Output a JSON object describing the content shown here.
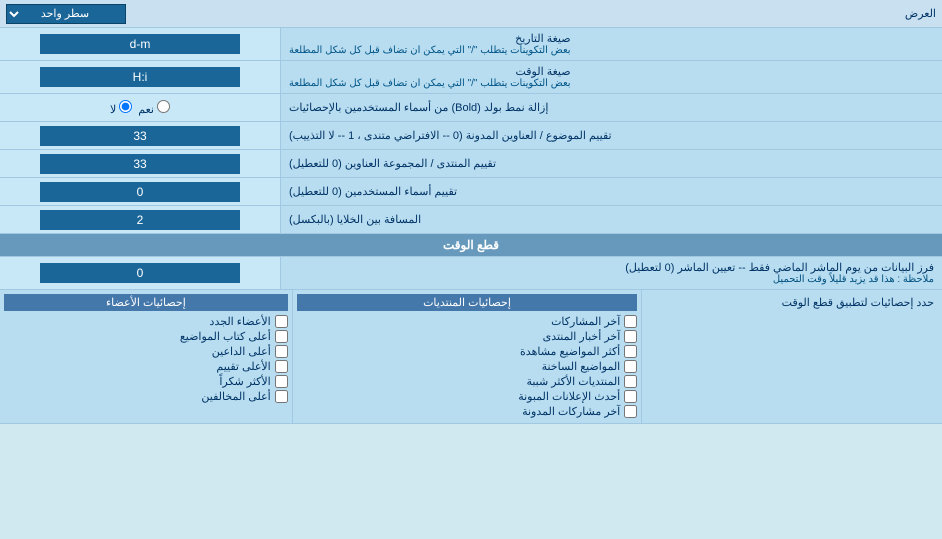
{
  "page": {
    "title": "العرض"
  },
  "rows": [
    {
      "id": "display-row",
      "label": "العرض",
      "input_type": "dropdown",
      "input_value": "سطر واحد"
    },
    {
      "id": "date-format",
      "label": "صيغة التاريخ",
      "sub_label": "بعض التكوينات يتطلب \"/\" التي يمكن ان تضاف قبل كل شكل المطلعة",
      "input_type": "text",
      "input_value": "d-m"
    },
    {
      "id": "time-format",
      "label": "صيغة الوقت",
      "sub_label": "بعض التكوينات يتطلب \"/\" التي يمكن ان تضاف قبل كل شكل المطلعة",
      "input_type": "text",
      "input_value": "H:i"
    },
    {
      "id": "remove-bold",
      "label": "إزالة نمط بولد (Bold) من أسماء المستخدمين بالإحصائيات",
      "input_type": "radio",
      "options": [
        {
          "label": "نعم",
          "value": "yes"
        },
        {
          "label": "لا",
          "value": "no",
          "checked": true
        }
      ]
    },
    {
      "id": "topics-order",
      "label": "تقييم الموضوع / العناوين المدونة (0 -- الافتراضي متندى ، 1 -- لا التذييب)",
      "input_type": "text",
      "input_value": "33"
    },
    {
      "id": "forum-order",
      "label": "تقييم المنتدى / المجموعة العناوين (0 للتعطيل)",
      "input_type": "text",
      "input_value": "33"
    },
    {
      "id": "usernames-order",
      "label": "تقييم أسماء المستخدمين (0 للتعطيل)",
      "input_type": "text",
      "input_value": "0"
    },
    {
      "id": "cell-spacing",
      "label": "المسافة بين الخلايا (بالبكسل)",
      "input_type": "text",
      "input_value": "2"
    }
  ],
  "cut_time_section": {
    "title": "قطع الوقت",
    "row": {
      "label": "فرز البيانات من يوم الماشر الماضي فقط -- تعيين الماشر (0 لتعطيل)",
      "sub_label": "ملاحظة : هذا قد يزيد قليلاً وقت التحميل",
      "input_value": "0"
    }
  },
  "stats_section": {
    "title": "حدد إحصائيات لتطبيق قطع الوقت",
    "col1_title": "إحصائيات المنتديات",
    "col2_title": "إحصائيات الأعضاء",
    "col1_items": [
      "آخر المشاركات",
      "آخر أخبار المنتدى",
      "أكثر المواضيع مشاهدة",
      "المواضيع الساخنة",
      "المنتديات الأكثر شببة",
      "أحدث الإعلانات المبونة",
      "آخر مشاركات المدونة"
    ],
    "col2_items": [
      "الأعضاء الجدد",
      "أعلى كتاب المواضيع",
      "أعلى الداعين",
      "الأعلى تقييم",
      "الأكثر شكراً",
      "أعلى المخالفين"
    ]
  }
}
